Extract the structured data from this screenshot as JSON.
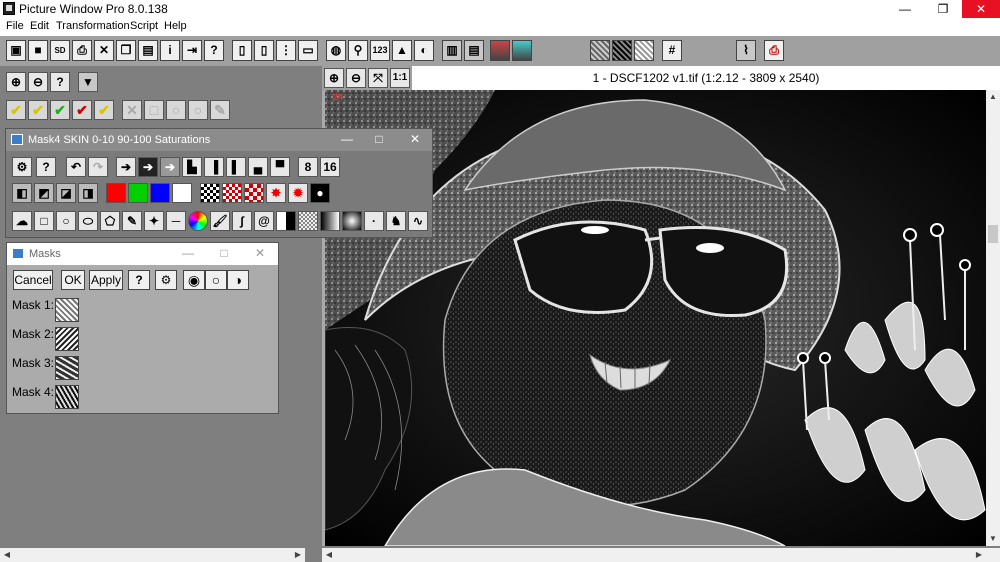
{
  "app": {
    "title": "Picture Window Pro 8.0.138",
    "window_controls": {
      "minimize": "—",
      "maximize": "❐",
      "close": "✕"
    }
  },
  "menu": [
    "File",
    "Edit",
    "Transformation",
    "Script",
    "Help"
  ],
  "toolbar": {
    "info": "i",
    "help": "?",
    "label_123": "123",
    "label_sd": "SD"
  },
  "left_panel": {
    "zoom_in": "🔍",
    "zoom_out": "🔍",
    "help": "?",
    "dropdown": "▼"
  },
  "image_window": {
    "caption": "1 - DSCF1202 v1.tif (1:2.12 - 3809 x 2540)",
    "zoom_1to1": "1:1",
    "corner_mark": "24"
  },
  "mask4_window": {
    "title": "Mask4 SKIN 0-10 90-100 Saturations",
    "btn_8": "8",
    "btn_16": "16",
    "help": "?"
  },
  "masks_window": {
    "title": "Masks",
    "cancel": "Cancel",
    "ok": "OK",
    "apply": "Apply",
    "help": "?",
    "mask_labels": [
      "Mask 1:",
      "Mask 2:",
      "Mask 3:",
      "Mask 4:"
    ]
  },
  "colors": {
    "accent_close": "#e81123",
    "swatch_red": "#ff0000",
    "swatch_green": "#00d000",
    "swatch_blue": "#0000ff",
    "swatch_white": "#ffffff"
  }
}
